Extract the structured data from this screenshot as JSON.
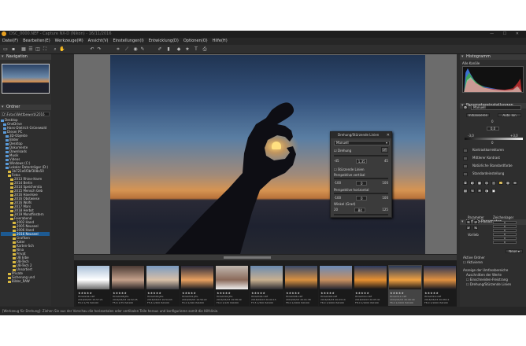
{
  "app": {
    "title": "DSC_0000.NEF - Capture NX-D (Nikon) - 16/11/2016",
    "logo_icon": "nx-logo-icon",
    "window_controls": "— ☐ ✕"
  },
  "menu": [
    "Datei(F)",
    "Bearbeiten(E)",
    "Werkzeuge(M)",
    "Ansicht(V)",
    "Einstellungen(I)",
    "Entwicklung(D)",
    "Optionen(O)",
    "Hilfe(H)"
  ],
  "toolbar_icons": [
    "folder-icon",
    "save-icon",
    "grid-icon",
    "list-icon",
    "compare-icon",
    "fullscreen-icon",
    "zoom-icon",
    "hand-icon",
    "rotate-left-icon",
    "rotate-right-icon",
    "crop-icon",
    "straighten-icon",
    "redeye-icon",
    "retouch-icon",
    "picker-icon",
    "histogram-icon",
    "label-icon",
    "rating-icon",
    "text-icon",
    "print-icon"
  ],
  "navigation": {
    "title": "Navigation"
  },
  "folders": {
    "title": "Ordner",
    "path": "D:\\Fotos\\Wettbewerb\\2016",
    "items": [
      {
        "label": "Desktop",
        "depth": 0,
        "sel": false
      },
      {
        "label": "OneDrive",
        "depth": 1,
        "sel": false
      },
      {
        "label": "Hans-Dietrich Grünewald",
        "depth": 1,
        "sel": false
      },
      {
        "label": "Dieser PC",
        "depth": 1,
        "sel": false
      },
      {
        "label": "3D-Objekte",
        "depth": 2,
        "sel": false
      },
      {
        "label": "Bilder",
        "depth": 2,
        "sel": false
      },
      {
        "label": "Desktop",
        "depth": 2,
        "sel": false
      },
      {
        "label": "Dokumente",
        "depth": 2,
        "sel": false
      },
      {
        "label": "Downloads",
        "depth": 2,
        "sel": false
      },
      {
        "label": "Musik",
        "depth": 2,
        "sel": false
      },
      {
        "label": "Videos",
        "depth": 2,
        "sel": false
      },
      {
        "label": "Windows (C:)",
        "depth": 2,
        "sel": false
      },
      {
        "label": "Lokaler Datenträger (D:)",
        "depth": 2,
        "sel": false
      },
      {
        "label": "1b721e6f3bf308a50",
        "depth": 3,
        "sel": false
      },
      {
        "label": "Fotos",
        "depth": 3,
        "sel": false
      },
      {
        "label": "2013 Rhine-Harm",
        "depth": 4,
        "sel": false
      },
      {
        "label": "2014 Berlin",
        "depth": 4,
        "sel": false
      },
      {
        "label": "2014 Speichersta",
        "depth": 4,
        "sel": false
      },
      {
        "label": "2015 Mensch Geb",
        "depth": 4,
        "sel": false
      },
      {
        "label": "2016 Havelsee",
        "depth": 4,
        "sel": false
      },
      {
        "label": "2016 Obstwiese",
        "depth": 4,
        "sel": false
      },
      {
        "label": "2016 Wolfs",
        "depth": 4,
        "sel": false
      },
      {
        "label": "2017 Mars",
        "depth": 4,
        "sel": false
      },
      {
        "label": "2018 Herbst",
        "depth": 4,
        "sel": false
      },
      {
        "label": "2019 Mondfinstern",
        "depth": 4,
        "sel": false
      },
      {
        "label": "Feierabend",
        "depth": 4,
        "sel": false
      },
      {
        "label": "2002 Hand",
        "depth": 5,
        "sel": false
      },
      {
        "label": "2005 Neuseel",
        "depth": 5,
        "sel": false
      },
      {
        "label": "2006 Hand",
        "depth": 5,
        "sel": false
      },
      {
        "label": "2016 Neuseel",
        "depth": 5,
        "sel": true
      },
      {
        "label": "Grafiken",
        "depth": 5,
        "sel": false
      },
      {
        "label": "Kater",
        "depth": 5,
        "sel": false
      },
      {
        "label": "Karten-Sch",
        "depth": 5,
        "sel": false
      },
      {
        "label": "Nina",
        "depth": 5,
        "sel": false
      },
      {
        "label": "Privat",
        "depth": 5,
        "sel": false
      },
      {
        "label": "UB Elbe",
        "depth": 5,
        "sel": false
      },
      {
        "label": "UB-Tech",
        "depth": 5,
        "sel": false
      },
      {
        "label": "UB-Tech 2",
        "depth": 5,
        "sel": false
      },
      {
        "label": "Unsortiert",
        "depth": 5,
        "sel": false
      },
      {
        "label": "Private",
        "depth": 3,
        "sel": false
      },
      {
        "label": "Sicherung und",
        "depth": 3,
        "sel": false
      },
      {
        "label": "Bilder_RAW",
        "depth": 3,
        "sel": false
      }
    ]
  },
  "viewer": {
    "zoom_label": "◂ ▸"
  },
  "dialog": {
    "title": "Drehung/Stürzende Linien",
    "mode": "Manuell",
    "rotation_label": "Drehung",
    "rotation_min": "-45",
    "rotation_val": "1,35",
    "rotation_max": "45",
    "persp_label": "Stürzende Linien",
    "pv_label": "Perspektive vertikal",
    "pv_min": "-100",
    "pv_val": "0",
    "pv_max": "100",
    "ph_label": "Perspektive horizontal",
    "ph_min": "-100",
    "ph_val": "0",
    "ph_max": "100",
    "angle_label": "Winkel (Grad)",
    "angle_min": "20",
    "angle_val": "84",
    "angle_max": "125"
  },
  "filmstrip": {
    "thumbs": [
      {
        "name": "HDG0294.CRF",
        "date": "2016/03/03 15:57:21",
        "exp": "F9.0 1/75 ISO100",
        "colors": [
          "#a9c0d8",
          "#ffffff",
          "#6a6a6a"
        ]
      },
      {
        "name": "HDG0298.JPG",
        "date": "2016/03/03 19:52:25",
        "exp": "F5.6 1/75 ISO100",
        "colors": [
          "#4a3a34",
          "#c4a08a",
          "#2a2426"
        ]
      },
      {
        "name": "HDG0300.JPG",
        "date": "2016/03/03 19:54:03",
        "exp": "F5.6 1/200 ISO100",
        "colors": [
          "#7a9ac0",
          "#d8c0a8",
          "#3a3a40"
        ]
      },
      {
        "name": "HDG0301.JPG",
        "date": "2016/03/03 19:56:22",
        "exp": "F4.0 1/160 ISO200",
        "colors": [
          "#2a2a3a",
          "#e8a060",
          "#1a1a20"
        ]
      },
      {
        "name": "HDG0302.JPG",
        "date": "2016/03/03 19:58:49",
        "exp": "F4.0 1/125 ISO200",
        "colors": [
          "#c0b8b0",
          "#8a6a5a",
          "#f0f0f0"
        ]
      },
      {
        "name": "HDG0304.CRF",
        "date": "2016/03/03 20:00:15",
        "exp": "F3.5 1/320 ISO100",
        "colors": [
          "#6a8ab0",
          "#c8b090",
          "#2a2a30"
        ]
      },
      {
        "name": "HDG0306.CRF",
        "date": "2016/03/03 20:01:38",
        "exp": "F8.0 1/1000 ISO100",
        "colors": [
          "#3a4a6a",
          "#d89040",
          "#1a1a22"
        ]
      },
      {
        "name": "HDG0308.CRF",
        "date": "2016/03/03 20:03:14",
        "exp": "F8.0 1/1000 ISO100",
        "colors": [
          "#6a8ab8",
          "#c89060",
          "#222430"
        ]
      },
      {
        "name": "HDG0310.CRF",
        "date": "2016/03/03 20:05:41",
        "exp": "F8.0 1/1000 ISO100",
        "colors": [
          "#2a3a60",
          "#e89030",
          "#121218"
        ]
      },
      {
        "name": "HDG0312.CRF",
        "date": "2016/03/03 20:06:44",
        "exp": "F8.0 1/1000 ISO100",
        "colors": [
          "#2a3a5a",
          "#f0a040",
          "#141418"
        ]
      },
      {
        "name": "HDG0316.CRF",
        "date": "2016/03/03 20:08:11",
        "exp": "F8.0 1/1000 ISO100",
        "colors": [
          "#2a3454",
          "#e09040",
          "#181820"
        ]
      }
    ],
    "stars": "★★★★★"
  },
  "status": {
    "text": "[Werkzeug für Drehung]: Ziehen Sie aus der Vorschau die horizontalen oder vertikalen Teile heraus und konfigurieren somit die Hilfslinie."
  },
  "right_panel": {
    "histogram_title": "Histogramm",
    "histogram_channel": "Alle Kanäle",
    "params_title": "Parametereinstellungen",
    "preset": "Manuell",
    "init_btn": "Initialisieren",
    "autotone_btn": "Auto Ton",
    "val_left": "-3,0",
    "val_mid": "0,0",
    "val_right": "+3,0",
    "zero1": "0",
    "zero2": "0",
    "menu_items": [
      "Kontrastkorrekturen",
      "Mittlerer Kontrast",
      "Natürliche Standardfarbe",
      "Standardeinstellung"
    ],
    "presets_title": "Vorlieb-Parameter",
    "persp_label": "Parameter",
    "ydisplay_label": "Zeichenlager",
    "vorlieb_label": "Vorlieb",
    "reset_btn": "Neue ▾",
    "active_label": "Aktive Ordner",
    "active_btn": "Aktivieren",
    "fields": [
      "0",
      "0",
      "0",
      "0",
      "0",
      "0"
    ],
    "extra1": "Anzeige der Umfassbereiche",
    "extra2": "Auschnitten der Werte",
    "extra3": "Einschneiden-Freistrang",
    "extra4": "Drehung/Stürzende Linien"
  }
}
